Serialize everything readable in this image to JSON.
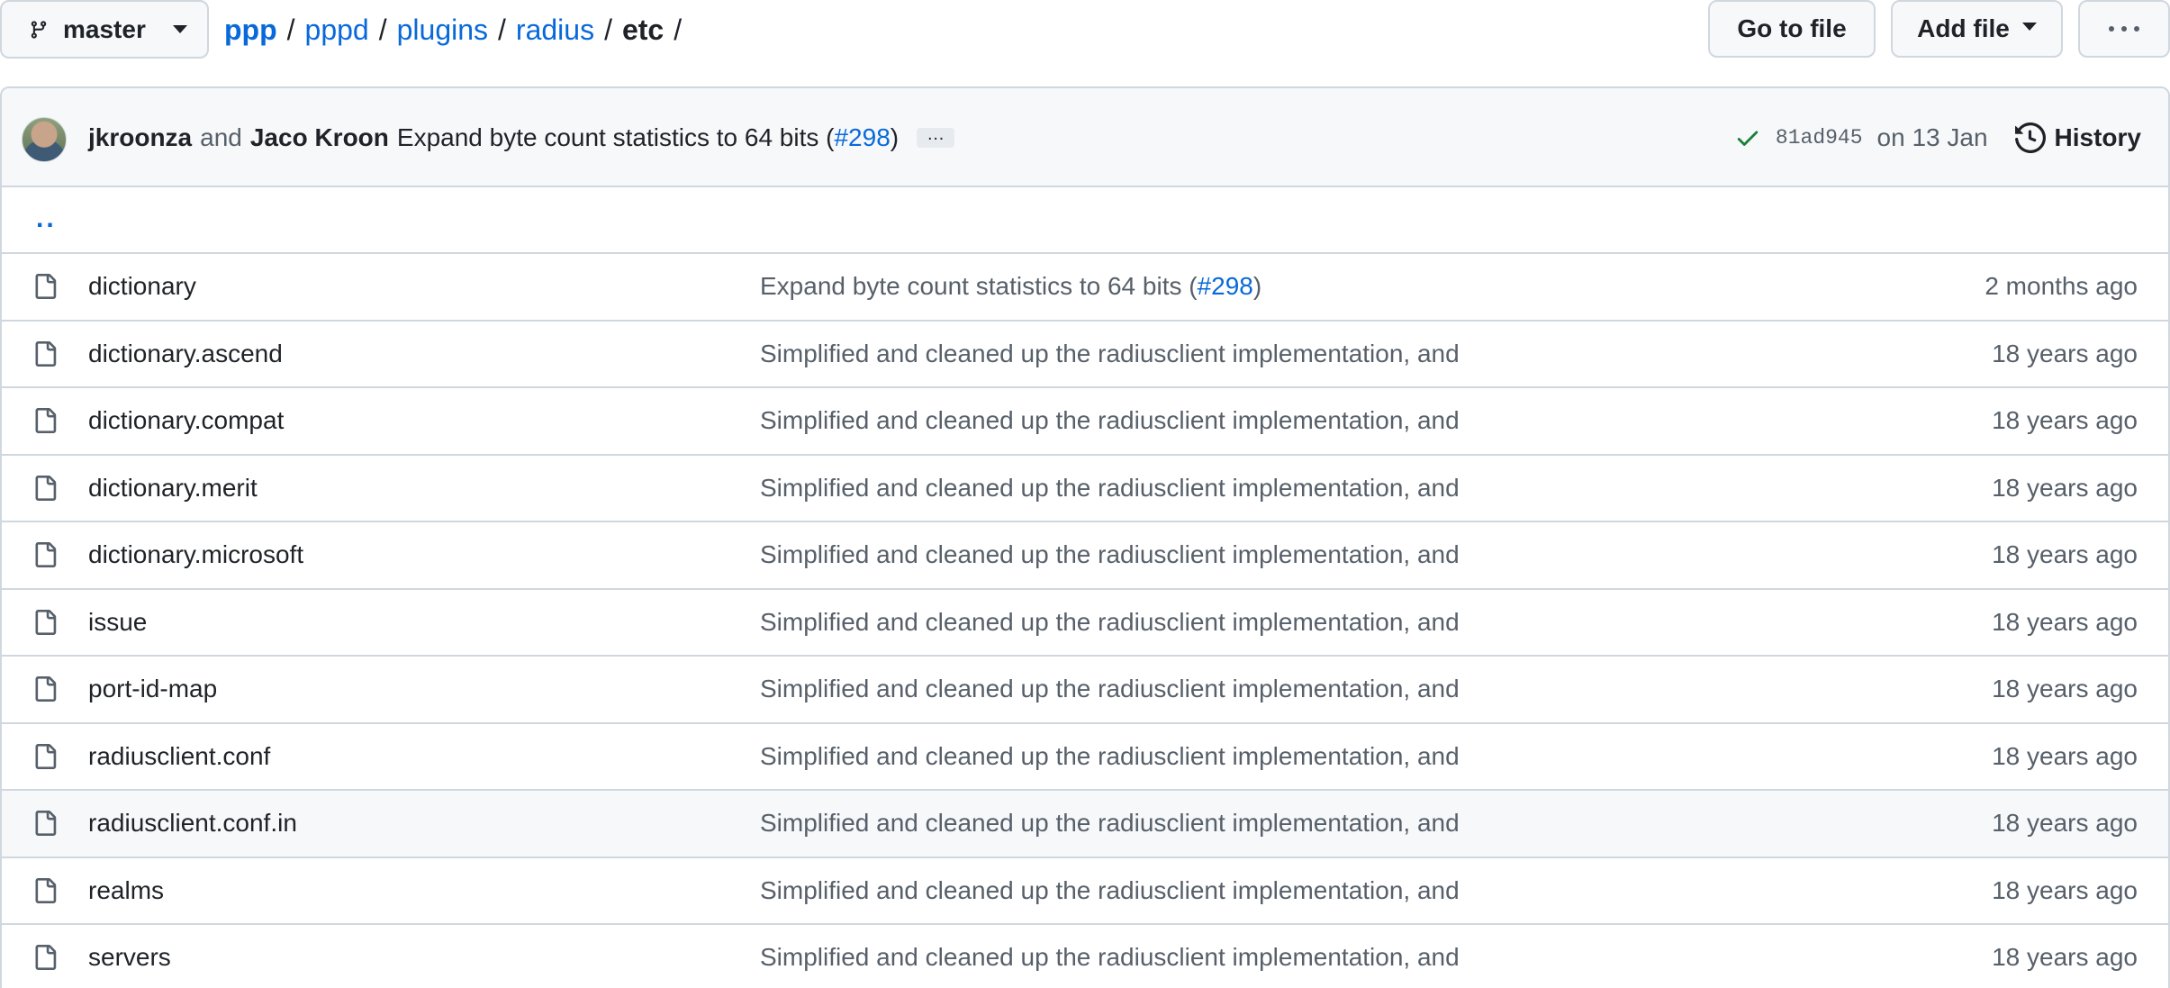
{
  "branch": {
    "name": "master"
  },
  "breadcrumb": {
    "root": "ppp",
    "segments": [
      "pppd",
      "plugins",
      "radius"
    ],
    "current": "etc",
    "separator": "/"
  },
  "actions": {
    "goto_file": "Go to file",
    "add_file": "Add file"
  },
  "commit": {
    "author1": "jkroonza",
    "conjunction": "and",
    "author2": "Jaco Kroon",
    "message": "Expand byte count statistics to 64 bits (",
    "pr": "#298",
    "message_end": ")",
    "ellipsis": "…",
    "sha": "81ad945",
    "date": "on 13 Jan",
    "history": "History",
    "status_color": "#1a7f37"
  },
  "parent_dir": "..",
  "files": [
    {
      "name": "dictionary",
      "message": "Expand byte count statistics to 64 bits (",
      "pr": "#298",
      "message_end": ")",
      "age": "2 months ago"
    },
    {
      "name": "dictionary.ascend",
      "message": "Simplified and cleaned up the radiusclient implementation, and",
      "age": "18 years ago"
    },
    {
      "name": "dictionary.compat",
      "message": "Simplified and cleaned up the radiusclient implementation, and",
      "age": "18 years ago"
    },
    {
      "name": "dictionary.merit",
      "message": "Simplified and cleaned up the radiusclient implementation, and",
      "age": "18 years ago"
    },
    {
      "name": "dictionary.microsoft",
      "message": "Simplified and cleaned up the radiusclient implementation, and",
      "age": "18 years ago"
    },
    {
      "name": "issue",
      "message": "Simplified and cleaned up the radiusclient implementation, and",
      "age": "18 years ago"
    },
    {
      "name": "port-id-map",
      "message": "Simplified and cleaned up the radiusclient implementation, and",
      "age": "18 years ago"
    },
    {
      "name": "radiusclient.conf",
      "message": "Simplified and cleaned up the radiusclient implementation, and",
      "age": "18 years ago"
    },
    {
      "name": "radiusclient.conf.in",
      "message": "Simplified and cleaned up the radiusclient implementation, and",
      "age": "18 years ago"
    },
    {
      "name": "realms",
      "message": "Simplified and cleaned up the radiusclient implementation, and",
      "age": "18 years ago"
    },
    {
      "name": "servers",
      "message": "Simplified and cleaned up the radiusclient implementation, and",
      "age": "18 years ago"
    }
  ],
  "colors": {
    "link": "#0969da",
    "muted": "#57606a",
    "border": "#d0d7de",
    "header_bg": "#f6f8fa"
  }
}
